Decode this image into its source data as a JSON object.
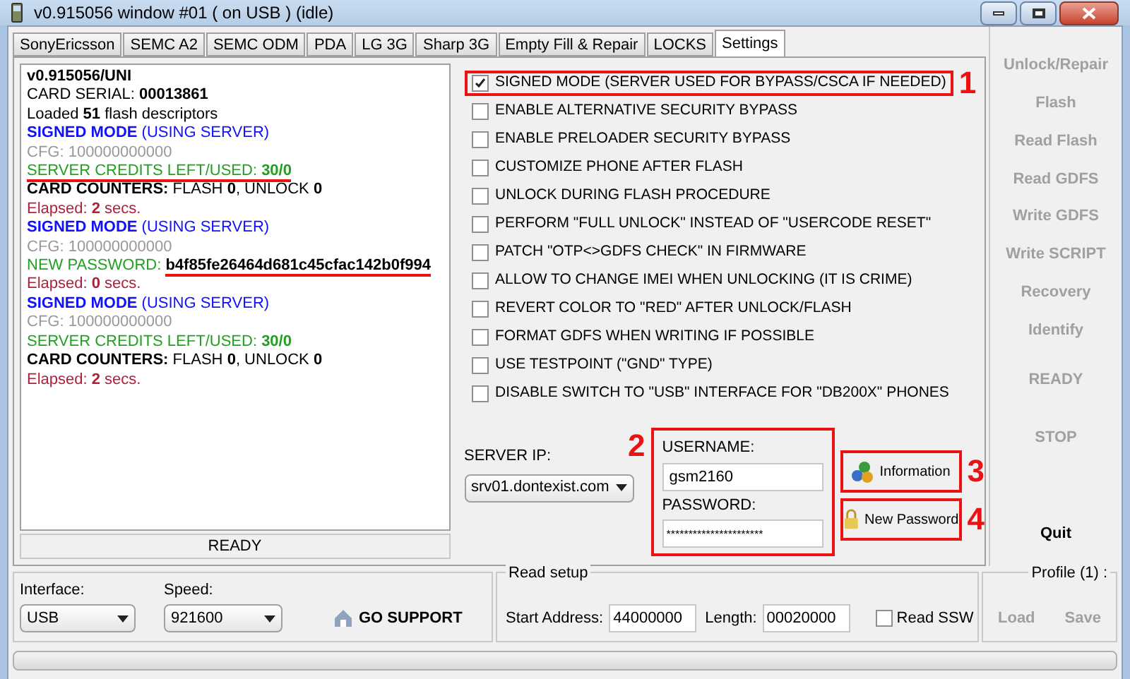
{
  "window": {
    "title": "v0.915056 window #01 ( on USB ) (idle)"
  },
  "tabs": [
    {
      "label": "SonyEricsson",
      "selected": false
    },
    {
      "label": "SEMC A2",
      "selected": false
    },
    {
      "label": "SEMC ODM",
      "selected": false
    },
    {
      "label": "PDA",
      "selected": false
    },
    {
      "label": "LG 3G",
      "selected": false
    },
    {
      "label": "Sharp 3G",
      "selected": false
    },
    {
      "label": "Empty Fill & Repair",
      "selected": false
    },
    {
      "label": "LOCKS",
      "selected": false
    },
    {
      "label": "Settings",
      "selected": true
    }
  ],
  "log": [
    [
      {
        "text": "v0.915056/UNI",
        "kind": "value"
      }
    ],
    [
      {
        "text": "CARD SERIAL: ",
        "kind": "text"
      },
      {
        "text": "00013861",
        "kind": "value"
      }
    ],
    [
      {
        "text": "Loaded ",
        "kind": "text"
      },
      {
        "text": "51",
        "kind": "value"
      },
      {
        "text": " flash descriptors",
        "kind": "text"
      }
    ],
    [
      {
        "text": "SIGNED MODE",
        "kind": "mode"
      },
      {
        "text": " (USING SERVER)",
        "kind": "mode-note"
      }
    ],
    [
      {
        "text": "CFG: 100000000000",
        "kind": "config"
      }
    ],
    [
      {
        "text": "SERVER CREDITS LEFT/USED: ",
        "kind": "server",
        "underlined": true
      },
      {
        "text": "30/0",
        "kind": "server-value",
        "underlined": true
      }
    ],
    [
      {
        "text": "CARD COUNTERS:",
        "kind": "value"
      },
      {
        "text": " FLASH ",
        "kind": "text"
      },
      {
        "text": "0",
        "kind": "value"
      },
      {
        "text": ", UNLOCK ",
        "kind": "text"
      },
      {
        "text": "0",
        "kind": "value"
      }
    ],
    [
      {
        "text": "Elapsed: ",
        "kind": "timing"
      },
      {
        "text": "2",
        "kind": "timing-value"
      },
      {
        "text": " secs.",
        "kind": "timing"
      }
    ],
    [
      {
        "text": "SIGNED MODE",
        "kind": "mode"
      },
      {
        "text": " (USING SERVER)",
        "kind": "mode-note"
      }
    ],
    [
      {
        "text": "CFG: 100000000000",
        "kind": "config"
      }
    ],
    [
      {
        "text": "NEW PASSWORD: ",
        "kind": "server"
      },
      {
        "text": "b4f85fe26464d681c45cfac142b0f994",
        "kind": "value",
        "underlined": true
      }
    ],
    [
      {
        "text": "Elapsed: ",
        "kind": "timing"
      },
      {
        "text": "0",
        "kind": "timing-value"
      },
      {
        "text": " secs.",
        "kind": "timing"
      }
    ],
    [
      {
        "text": "SIGNED MODE",
        "kind": "mode"
      },
      {
        "text": " (USING SERVER)",
        "kind": "mode-note"
      }
    ],
    [
      {
        "text": "CFG: 100000000000",
        "kind": "config"
      }
    ],
    [
      {
        "text": "SERVER CREDITS LEFT/USED: ",
        "kind": "server"
      },
      {
        "text": "30/0",
        "kind": "server-value"
      }
    ],
    [
      {
        "text": "CARD COUNTERS:",
        "kind": "value"
      },
      {
        "text": " FLASH ",
        "kind": "text"
      },
      {
        "text": "0",
        "kind": "value"
      },
      {
        "text": ", UNLOCK ",
        "kind": "text"
      },
      {
        "text": "0",
        "kind": "value"
      }
    ],
    [
      {
        "text": "Elapsed: ",
        "kind": "timing"
      },
      {
        "text": "2",
        "kind": "timing-value"
      },
      {
        "text": " secs.",
        "kind": "timing"
      }
    ]
  ],
  "log_status": "READY",
  "options": [
    {
      "label": "SIGNED MODE (SERVER USED FOR BYPASS/CSCA IF NEEDED)",
      "checked": true,
      "highlighted": true,
      "marker": "1"
    },
    {
      "label": "ENABLE ALTERNATIVE SECURITY BYPASS",
      "checked": false,
      "highlighted": false
    },
    {
      "label": "ENABLE PRELOADER SECURITY BYPASS",
      "checked": false,
      "highlighted": false
    },
    {
      "label": "CUSTOMIZE PHONE AFTER FLASH",
      "checked": false,
      "highlighted": false
    },
    {
      "label": "UNLOCK DURING FLASH PROCEDURE",
      "checked": false,
      "highlighted": false
    },
    {
      "label": "PERFORM \"FULL UNLOCK\" INSTEAD OF \"USERCODE RESET\"",
      "checked": false,
      "highlighted": false
    },
    {
      "label": "PATCH \"OTP<>GDFS CHECK\" IN FIRMWARE",
      "checked": false,
      "highlighted": false
    },
    {
      "label": "ALLOW TO CHANGE IMEI WHEN UNLOCKING (IT IS CRIME)",
      "checked": false,
      "highlighted": false
    },
    {
      "label": "REVERT COLOR TO \"RED\" AFTER UNLOCK/FLASH",
      "checked": false,
      "highlighted": false
    },
    {
      "label": "FORMAT GDFS WHEN WRITING IF POSSIBLE",
      "checked": false,
      "highlighted": false
    },
    {
      "label": "USE TESTPOINT (\"GND\" TYPE)",
      "checked": false,
      "highlighted": false
    },
    {
      "label": "DISABLE SWITCH TO \"USB\" INTERFACE FOR \"DB200X\" PHONES",
      "checked": false,
      "highlighted": false
    }
  ],
  "server": {
    "label": "SERVER IP:",
    "value": "srv01.dontexist.com"
  },
  "credentials": {
    "marker": "2",
    "username_label": "USERNAME:",
    "username": "gsm2160",
    "password_label": "PASSWORD:",
    "password": "**********************"
  },
  "server_buttons": [
    {
      "label": "Information",
      "kind": "info",
      "marker": "3"
    },
    {
      "label": "New Password",
      "kind": "lock",
      "marker": "4"
    }
  ],
  "actions": [
    {
      "label": "Unlock/Repair",
      "disabled": true
    },
    {
      "label": "Flash",
      "disabled": true
    },
    {
      "label": "Read Flash",
      "disabled": true
    },
    {
      "label": "Read GDFS",
      "disabled": true
    },
    {
      "label": "Write GDFS",
      "disabled": true
    },
    {
      "label": "Write SCRIPT",
      "disabled": true
    },
    {
      "label": "Recovery",
      "disabled": true
    },
    {
      "label": "Identify",
      "disabled": true
    }
  ],
  "status": "READY",
  "bottom_bar": {
    "visible": true
  },
  "stop": {
    "label": "STOP",
    "disabled": true
  },
  "quit": {
    "label": "Quit",
    "disabled": false
  },
  "interface": {
    "label": "Interface:",
    "value": "USB"
  },
  "speed": {
    "label": "Speed:",
    "value": "921600"
  },
  "support": {
    "label": "GO SUPPORT"
  },
  "read_setup": {
    "title": "Read setup",
    "start_label": "Start Address:",
    "start": "44000000",
    "length_label": "Length:",
    "length": "00020000",
    "ssw_label": "Read SSW",
    "ssw_checked": false
  },
  "profile": {
    "title": "Profile (1) :",
    "buttons": [
      {
        "label": "Load",
        "disabled": true
      },
      {
        "label": "Save",
        "disabled": true
      }
    ]
  }
}
